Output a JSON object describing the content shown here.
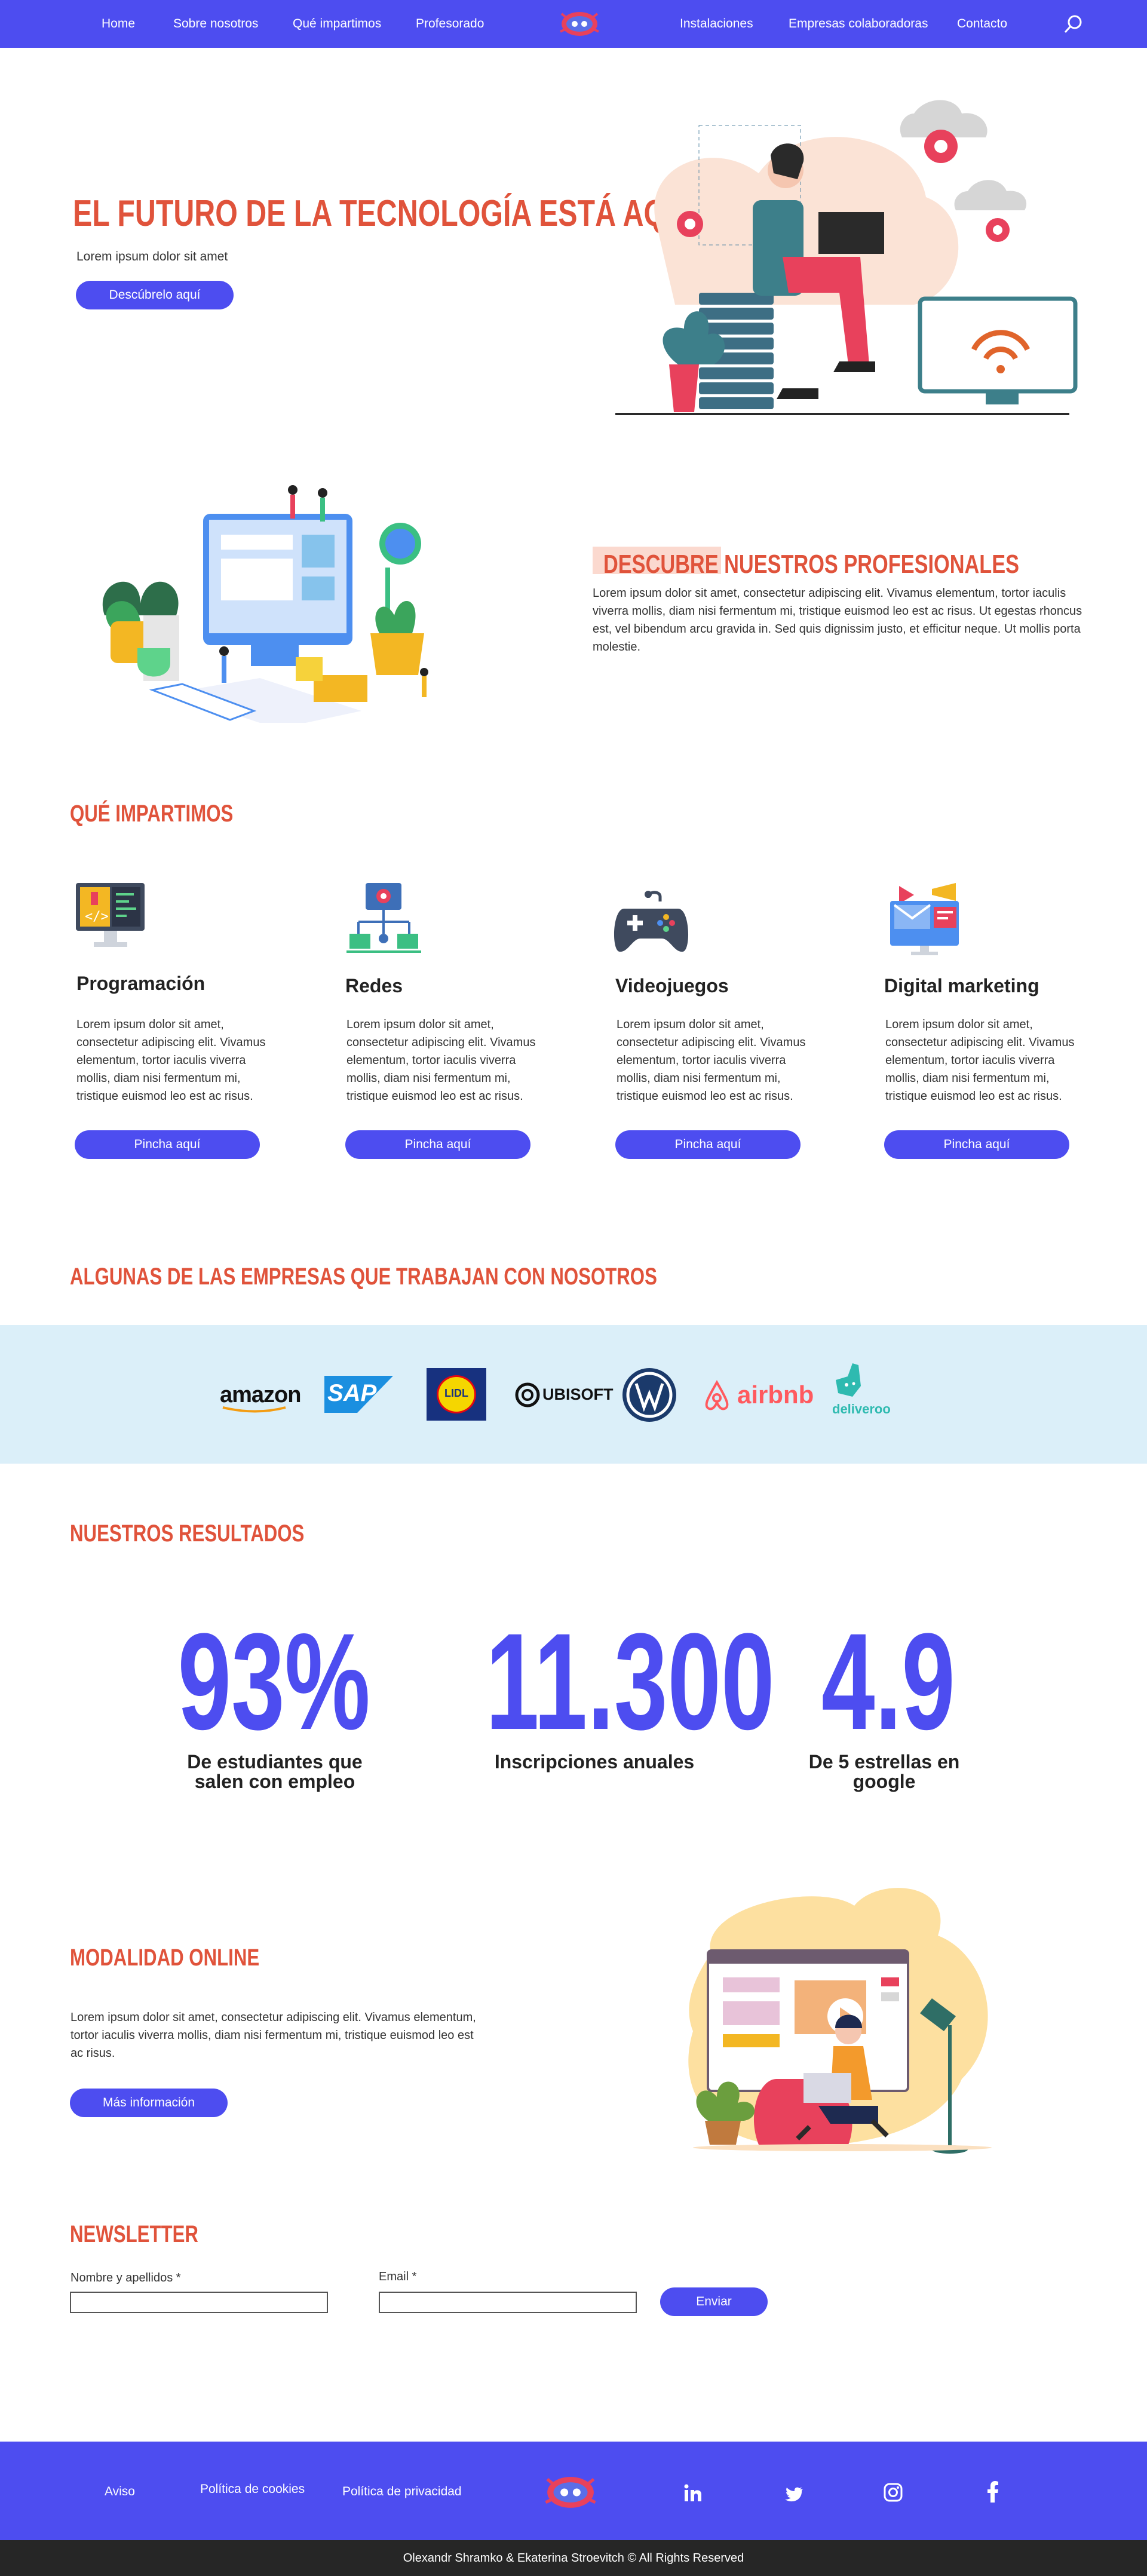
{
  "nav": {
    "items": [
      "Home",
      "Sobre nosotros",
      "Qué impartimos",
      "Profesorado",
      "Instalaciones",
      "Empresas colaboradoras",
      "Contacto"
    ]
  },
  "hero": {
    "title": "EL FUTURO DE LA TECNOLOGÍA ESTÁ AQUÍ",
    "subtitle": "Lorem ipsum dolor sit amet",
    "button": "Descúbrelo aquí"
  },
  "profesionales": {
    "title": "DESCUBRE NUESTROS PROFESIONALES",
    "text": "Lorem ipsum dolor sit amet, consectetur adipiscing elit. Vivamus elementum, tortor iaculis viverra mollis, diam nisi fermentum mi, tristique euismod leo est ac risus. Ut egestas rhoncus est, vel bibendum arcu gravida in. Sed quis dignissim justo, et efficitur neque. Ut mollis porta molestie."
  },
  "impartimos": {
    "title": "QUÉ IMPARTIMOS",
    "cards": [
      {
        "title": "Programación",
        "text": "Lorem ipsum dolor sit amet, consectetur adipiscing elit. Vivamus elementum, tortor iaculis viverra mollis, diam nisi fermentum mi, tristique euismod leo est ac risus.",
        "button": "Pincha aquí",
        "icon": "code-monitor-icon"
      },
      {
        "title": "Redes",
        "text": "Lorem ipsum dolor sit amet, consectetur adipiscing elit. Vivamus elementum, tortor iaculis viverra mollis, diam nisi fermentum mi, tristique euismod leo est ac risus.",
        "button": "Pincha aquí",
        "icon": "network-icon"
      },
      {
        "title": "Videojuegos",
        "text": "Lorem ipsum dolor sit amet, consectetur adipiscing elit. Vivamus elementum, tortor iaculis viverra mollis, diam nisi fermentum mi, tristique euismod leo est ac risus.",
        "button": "Pincha aquí",
        "icon": "gamepad-icon"
      },
      {
        "title": "Digital marketing",
        "text": "Lorem ipsum dolor sit amet, consectetur adipiscing elit. Vivamus elementum, tortor iaculis viverra mollis, diam nisi fermentum mi, tristique euismod leo est ac risus.",
        "button": "Pincha aquí",
        "icon": "marketing-icon"
      }
    ]
  },
  "empresas": {
    "title": "ALGUNAS DE LAS EMPRESAS QUE TRABAJAN CON NOSOTROS",
    "logos": [
      "amazon",
      "SAP",
      "LIDL",
      "UBISOFT",
      "VW",
      "airbnb",
      "deliveroo"
    ]
  },
  "resultados": {
    "title": "NUESTROS RESULTADOS",
    "stats": [
      {
        "value": "93%",
        "label1": "De estudiantes que",
        "label2": "salen con empleo"
      },
      {
        "value": "11.300",
        "label1": "Inscripciones anuales",
        "label2": ""
      },
      {
        "value": "4.9",
        "label1": "De 5 estrellas en",
        "label2": "google"
      }
    ]
  },
  "online": {
    "title": "MODALIDAD ONLINE",
    "text": "Lorem ipsum dolor sit amet, consectetur adipiscing elit. Vivamus elementum, tortor iaculis viverra mollis, diam nisi fermentum mi, tristique euismod leo est ac risus.",
    "button": "Más información"
  },
  "newsletter": {
    "title": "NEWSLETTER",
    "name_label": "Nombre y apellidos *",
    "email_label": "Email *",
    "button": "Enviar"
  },
  "footer": {
    "links": [
      "Aviso",
      "Política de cookies",
      "Política de privacidad"
    ],
    "social": [
      "linkedin-icon",
      "twitter-icon",
      "instagram-icon",
      "facebook-icon"
    ],
    "copyright": "Olexandr Shramko & Ekaterina Stroevitch © All Rights Reserved"
  },
  "colors": {
    "accent": "#4d4df0",
    "heading": "#e0533b",
    "partners_bg": "#dbeff9",
    "copyright_bg": "#262626"
  }
}
